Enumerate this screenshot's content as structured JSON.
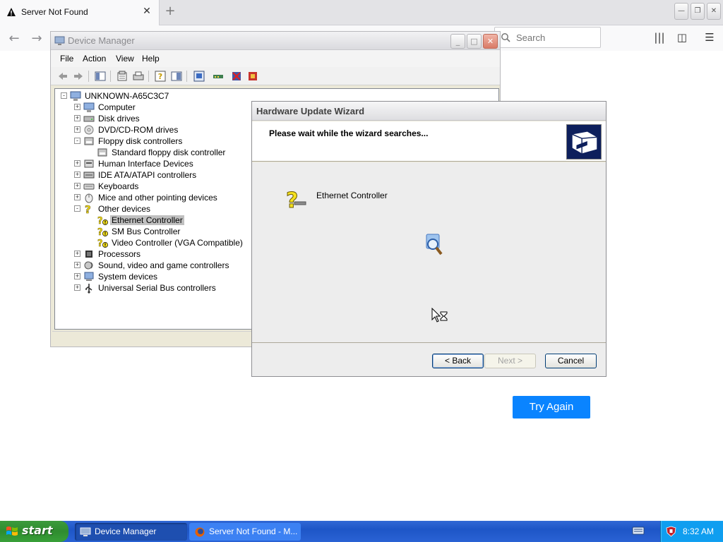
{
  "browser": {
    "tab_title": "Server Not Found",
    "search_placeholder": "Search",
    "try_again_label": "Try Again"
  },
  "device_manager": {
    "title": "Device Manager",
    "menu": [
      "File",
      "Action",
      "View",
      "Help"
    ],
    "tree": [
      {
        "label": "UNKNOWN-A65C3C7",
        "icon": "computer-icon"
      },
      {
        "label": "Computer",
        "icon": "computer-icon"
      },
      {
        "label": "Disk drives",
        "icon": "disk-drive-icon"
      },
      {
        "label": "DVD/CD-ROM drives",
        "icon": "cd-rom-icon"
      },
      {
        "label": "Floppy disk controllers",
        "icon": "floppy-controller-icon"
      },
      {
        "label": "Standard floppy disk controller",
        "icon": "floppy-controller-icon"
      },
      {
        "label": "Human Interface Devices",
        "icon": "hid-icon"
      },
      {
        "label": "IDE ATA/ATAPI controllers",
        "icon": "ide-controller-icon"
      },
      {
        "label": "Keyboards",
        "icon": "keyboard-icon"
      },
      {
        "label": "Mice and other pointing devices",
        "icon": "mouse-icon"
      },
      {
        "label": "Other devices",
        "icon": "unknown-device-icon"
      },
      {
        "label": "Ethernet Controller",
        "icon": "warning-device-icon"
      },
      {
        "label": "SM Bus Controller",
        "icon": "warning-device-icon"
      },
      {
        "label": "Video Controller (VGA Compatible)",
        "icon": "warning-device-icon"
      },
      {
        "label": "Processors",
        "icon": "processor-icon"
      },
      {
        "label": "Sound, video and game controllers",
        "icon": "sound-icon"
      },
      {
        "label": "System devices",
        "icon": "system-device-icon"
      },
      {
        "label": "Universal Serial Bus controllers",
        "icon": "usb-icon"
      }
    ]
  },
  "wizard": {
    "title": "Hardware Update Wizard",
    "heading": "Please wait while the wizard searches...",
    "device_name": "Ethernet Controller",
    "back_label": "< Back",
    "next_label": "Next >",
    "cancel_label": "Cancel"
  },
  "taskbar": {
    "start_label": "start",
    "tasks": [
      {
        "label": "Device Manager"
      },
      {
        "label": "Server Not Found - M..."
      }
    ],
    "clock": "8:32 AM"
  }
}
